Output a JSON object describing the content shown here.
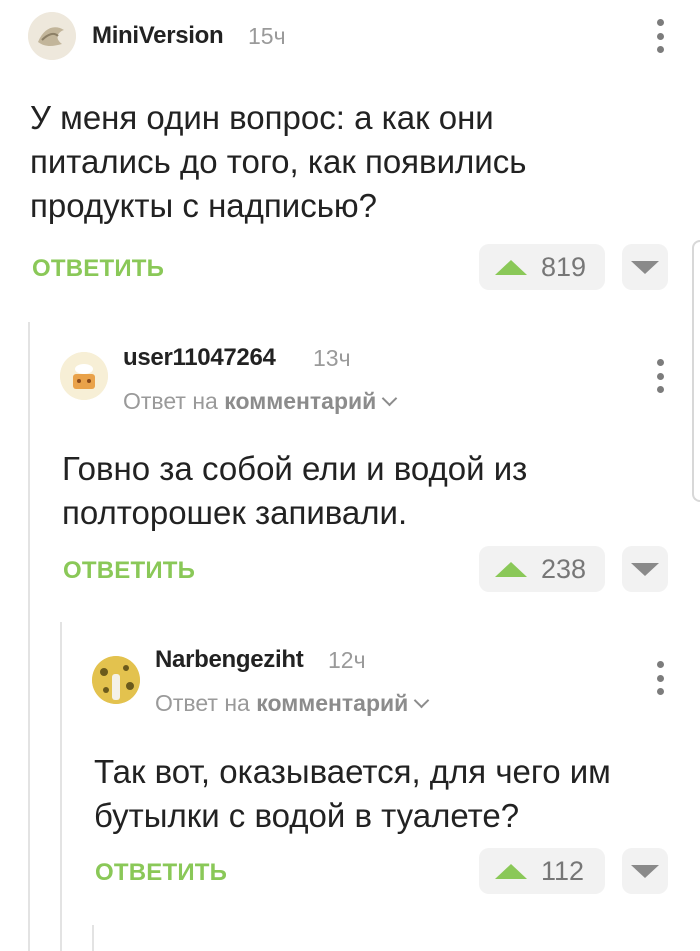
{
  "comments": [
    {
      "author": "MiniVersion",
      "time": "15ч",
      "text_lines": [
        "У меня один вопрос: а как они",
        "питались до того, как появились",
        "продукты с надписью?"
      ],
      "reply_label": "ОТВЕТИТЬ",
      "score": "819"
    },
    {
      "author": "user11047264",
      "time": "13ч",
      "reply_prefix": "Ответ на",
      "reply_target": "комментарий",
      "text_lines": [
        "Говно за собой ели и водой из",
        "полторошек запивали."
      ],
      "reply_label": "ОТВЕТИТЬ",
      "score": "238"
    },
    {
      "author": "Narbengeziht",
      "time": "12ч",
      "reply_prefix": "Ответ на",
      "reply_target": "комментарий",
      "text_lines": [
        "Так вот, оказывается, для чего им",
        "бутылки с водой в туалете?"
      ],
      "reply_label": "ОТВЕТИТЬ",
      "score": "112"
    }
  ],
  "colors": {
    "accent": "#8ac858",
    "muted": "#9a9a9a",
    "text": "#222222"
  },
  "icons": {
    "more": "more-vertical-icon",
    "upvote": "upvote-icon",
    "downvote": "downvote-icon",
    "chevron": "chevron-down-icon"
  }
}
